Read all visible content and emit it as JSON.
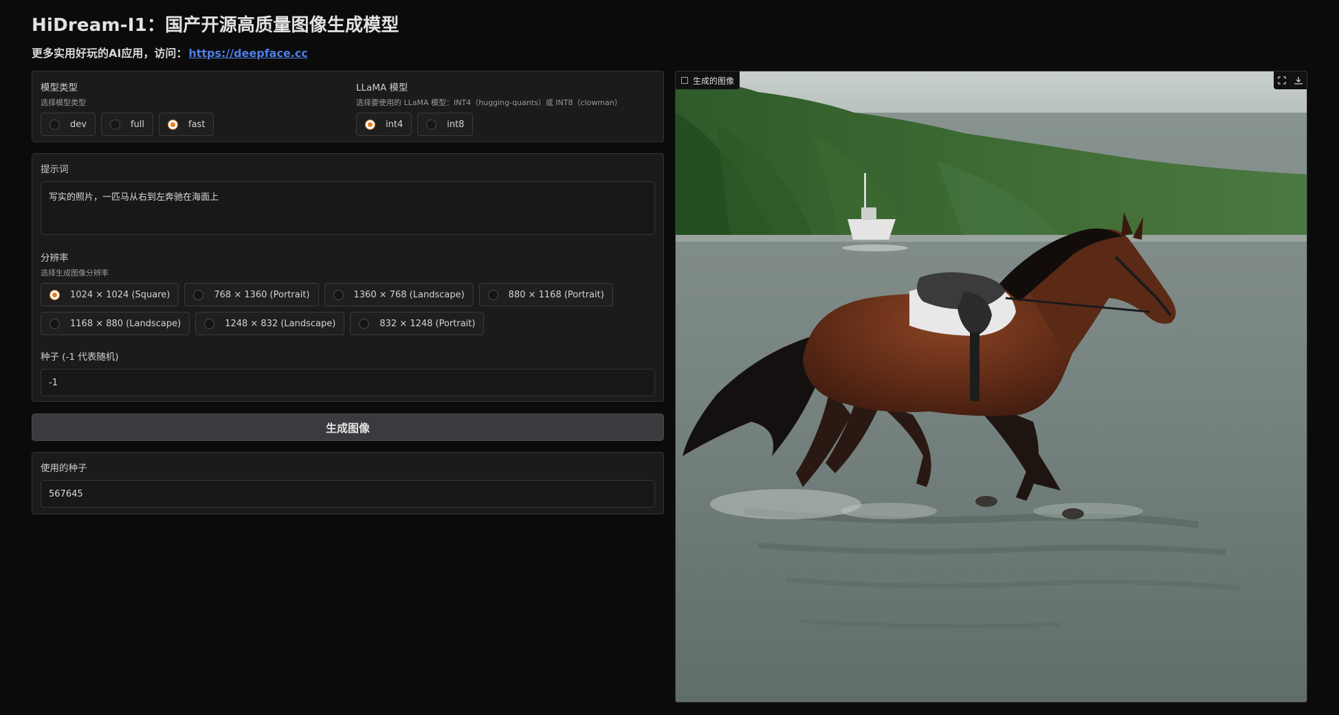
{
  "header": {
    "title": "HiDream-I1：国产开源高质量图像生成模型",
    "subtitle_prefix": "更多实用好玩的AI应用，访问：",
    "link_text": "https://deepface.cc"
  },
  "model_type": {
    "label": "模型类型",
    "hint": "选择模型类型",
    "options": [
      "dev",
      "full",
      "fast"
    ],
    "selected": "fast"
  },
  "llama_model": {
    "label": "LLaMA 模型",
    "hint": "选择要使用的 LLaMA 模型：INT4（hugging-quants）或 INT8（clowman）",
    "options": [
      "int4",
      "int8"
    ],
    "selected": "int4"
  },
  "prompt": {
    "label": "提示词",
    "value": "写实的照片，一匹马从右到左奔驰在海面上"
  },
  "resolution": {
    "label": "分辨率",
    "hint": "选择生成图像分辨率",
    "options": [
      "1024 × 1024 (Square)",
      "768 × 1360 (Portrait)",
      "1360 × 768 (Landscape)",
      "880 × 1168 (Portrait)",
      "1168 × 880 (Landscape)",
      "1248 × 832 (Landscape)",
      "832 × 1248 (Portrait)"
    ],
    "selected": "1024 × 1024 (Square)"
  },
  "seed": {
    "label": "种子 (-1 代表随机)",
    "value": "-1"
  },
  "generate_button": {
    "label": "生成图像"
  },
  "used_seed": {
    "label": "使用的种子",
    "value": "567645"
  },
  "output_image": {
    "label": "生成的图像",
    "fullscreen_icon": "fullscreen-icon",
    "download_icon": "download-icon"
  },
  "colors": {
    "accent": "#e07f2c",
    "link": "#4f7ee8",
    "background": "#0b0b0b",
    "panel": "#1b1b1b"
  }
}
